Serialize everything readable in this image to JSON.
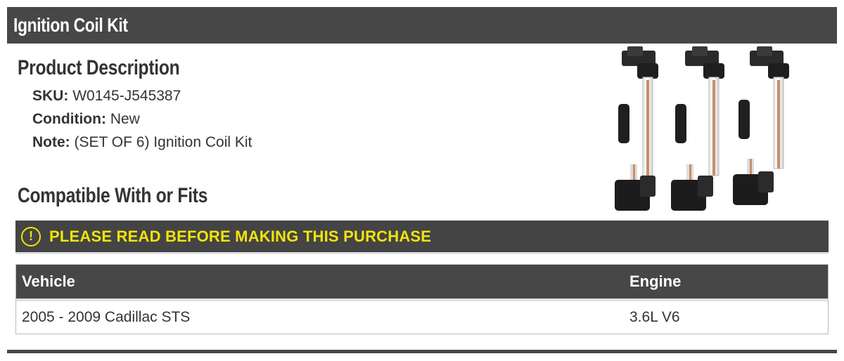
{
  "header": {
    "title": "Ignition Coil Kit"
  },
  "product_description": {
    "title": "Product Description",
    "specs": [
      {
        "label": "SKU:",
        "value": "W0145-J545387"
      },
      {
        "label": "Condition:",
        "value": "New"
      },
      {
        "label": "Note:",
        "value": "(SET OF 6) Ignition Coil Kit"
      }
    ]
  },
  "compatibility": {
    "title": "Compatible With or Fits",
    "warning": {
      "icon": "exclamation-circle-icon",
      "text": "PLEASE READ BEFORE MAKING THIS PURCHASE",
      "color": "#f1e40c"
    },
    "columns": {
      "vehicle": "Vehicle",
      "engine": "Engine"
    },
    "rows": [
      {
        "vehicle": "2005 - 2009 Cadillac STS",
        "engine": "3.6L V6"
      }
    ]
  },
  "colors": {
    "bar": "#474747",
    "accent": "#f1e40c"
  }
}
